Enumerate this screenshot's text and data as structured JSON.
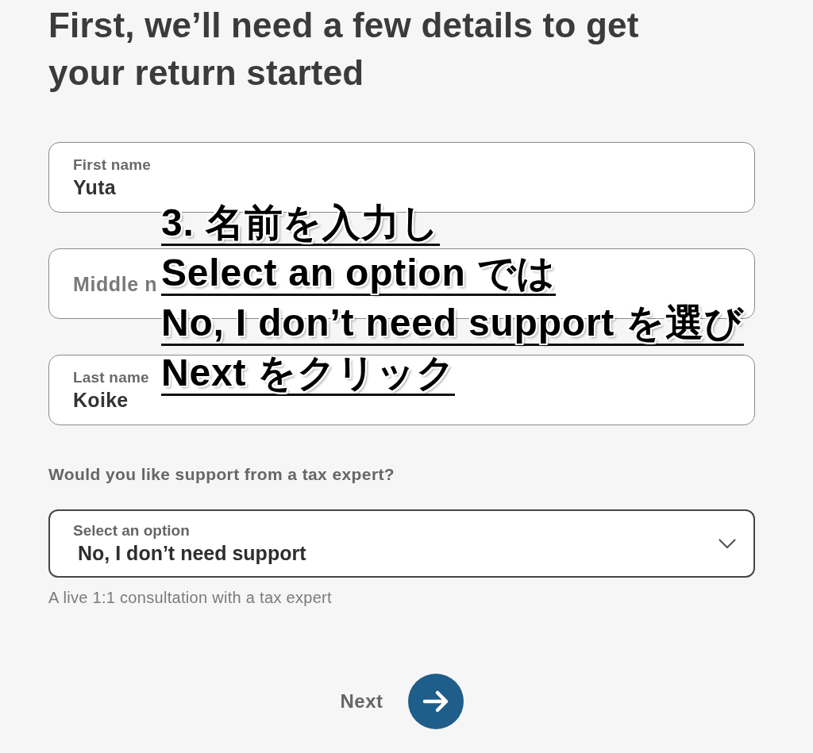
{
  "heading": "First, we’ll need a few details to get your return started",
  "fields": [
    {
      "label": "First name",
      "value": "Yuta"
    },
    {
      "placeholder": "Middle n"
    },
    {
      "label": "Last name",
      "value": "Koike"
    }
  ],
  "support": {
    "question": "Would you like support from a tax expert?",
    "select": {
      "label": "Select an option",
      "value": "No, I don’t need support"
    },
    "hint": "A live 1:1 consultation with a tax expert"
  },
  "next_button": {
    "label": "Next"
  },
  "annotation": {
    "lines": [
      "3. 名前を入力し",
      "Select an option では",
      "No, I don’t need support を選び",
      "Next をクリック"
    ]
  }
}
